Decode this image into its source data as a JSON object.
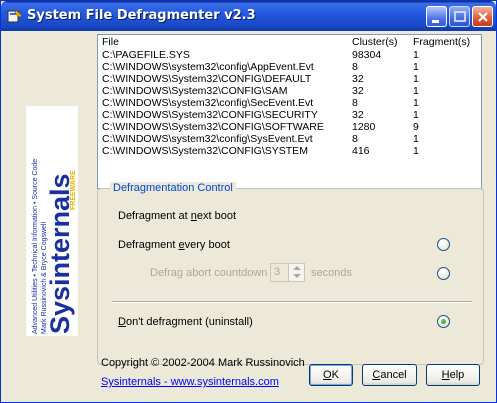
{
  "window": {
    "title": "System File Defragmenter v2.3"
  },
  "file_list": {
    "columns": [
      "File",
      "Cluster(s)",
      "Fragment(s)"
    ],
    "rows": [
      {
        "file": "C:\\PAGEFILE.SYS",
        "clusters": "98304",
        "fragments": "1"
      },
      {
        "file": "C:\\WINDOWS\\system32\\config\\AppEvent.Evt",
        "clusters": "8",
        "fragments": "1"
      },
      {
        "file": "C:\\WINDOWS\\System32\\CONFIG\\DEFAULT",
        "clusters": "32",
        "fragments": "1"
      },
      {
        "file": "C:\\WINDOWS\\System32\\CONFIG\\SAM",
        "clusters": "32",
        "fragments": "1"
      },
      {
        "file": "C:\\WINDOWS\\system32\\config\\SecEvent.Evt",
        "clusters": "8",
        "fragments": "1"
      },
      {
        "file": "C:\\WINDOWS\\System32\\CONFIG\\SECURITY",
        "clusters": "32",
        "fragments": "1"
      },
      {
        "file": "C:\\WINDOWS\\System32\\CONFIG\\SOFTWARE",
        "clusters": "1280",
        "fragments": "9"
      },
      {
        "file": "C:\\WINDOWS\\system32\\config\\SysEvent.Evt",
        "clusters": "8",
        "fragments": "1"
      },
      {
        "file": "C:\\WINDOWS\\System32\\CONFIG\\SYSTEM",
        "clusters": "416",
        "fragments": "1"
      }
    ]
  },
  "control": {
    "legend": "Defragmentation Control",
    "options": [
      {
        "pre": "Defragment at ",
        "accel": "n",
        "post": "ext boot",
        "selected": false
      },
      {
        "pre": "Defragment ",
        "accel": "e",
        "post": "very boot",
        "selected": false
      },
      {
        "pre": "",
        "accel": "D",
        "post": "on't defragment (uninstall)",
        "selected": true
      }
    ],
    "countdown_label": "Defrag abort countdown",
    "countdown_value": "3",
    "seconds_label": "seconds"
  },
  "footer": {
    "copyright": "Copyright © 2002-2004 Mark Russinovich",
    "link": "Sysinternals - www.sysinternals.com"
  },
  "buttons": {
    "ok": {
      "accel": "O",
      "rest": "K"
    },
    "cancel": {
      "accel": "C",
      "rest": "ancel"
    },
    "help": {
      "accel": "H",
      "rest": "elp"
    }
  },
  "logo": {
    "main": "Sysinternals",
    "freeware": "FREEWARE",
    "authors": "Mark Russinovich & Bryce Cogswell",
    "tagline": "Advanced Utilities • Technical Information • Source Code"
  },
  "colors": {
    "titlebar": "#2459e0",
    "legend": "#0046d5",
    "link": "#0000ff",
    "logo_blue": "#1a2fa0",
    "logo_gold": "#e8b400"
  }
}
